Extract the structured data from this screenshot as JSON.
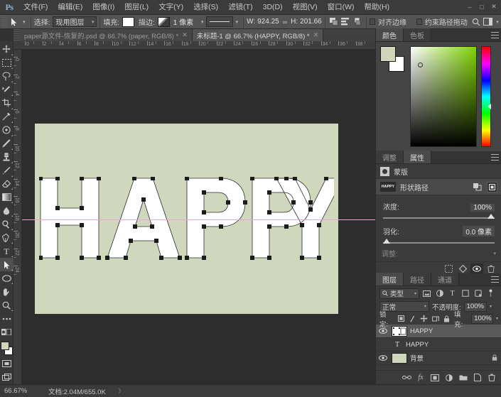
{
  "app": {
    "logo": "Ps",
    "window_buttons": [
      "–",
      "□",
      "✕"
    ]
  },
  "menubar": {
    "items": [
      {
        "label": "文件(F)"
      },
      {
        "label": "编辑(E)"
      },
      {
        "label": "图像(I)"
      },
      {
        "label": "图层(L)"
      },
      {
        "label": "文字(Y)"
      },
      {
        "label": "选择(S)"
      },
      {
        "label": "滤镜(T)"
      },
      {
        "label": "3D(D)"
      },
      {
        "label": "视图(V)"
      },
      {
        "label": "窗口(W)"
      },
      {
        "label": "帮助(H)"
      }
    ]
  },
  "optionsbar": {
    "tool_icon": "path-selection-icon",
    "select_label": "选择:",
    "select_value": "现用图层",
    "fill_label": "填充:",
    "fill_color": "#ffffff",
    "stroke_label": "描边:",
    "stroke_width": "1 像素",
    "stroke_style_label": "——",
    "w_label": "W:",
    "w_value": "924.25",
    "link_icon": "link-icon",
    "h_label": "H:",
    "h_value": "201.66",
    "align_edges_label": "对齐边缘",
    "constrain_path_label": "约束路径拖动"
  },
  "tabs": [
    {
      "label": "paper源文件-恢复的.psd @ 66.7% (paper, RGB/8) *",
      "active": false
    },
    {
      "label": "未标题-1 @ 66.7% (HAPPY, RGB/8) *",
      "active": true
    }
  ],
  "toolbar": {
    "tools": [
      {
        "name": "move-tool",
        "active": false
      },
      {
        "name": "rectangular-marquee-tool",
        "active": false
      },
      {
        "name": "lasso-tool",
        "active": false
      },
      {
        "name": "quick-selection-tool",
        "active": false
      },
      {
        "name": "crop-tool",
        "active": false
      },
      {
        "name": "eyedropper-tool",
        "active": false
      },
      {
        "name": "spot-healing-brush-tool",
        "active": false
      },
      {
        "name": "brush-tool",
        "active": false
      },
      {
        "name": "clone-stamp-tool",
        "active": false
      },
      {
        "name": "history-brush-tool",
        "active": false
      },
      {
        "name": "eraser-tool",
        "active": false
      },
      {
        "name": "gradient-tool",
        "active": false
      },
      {
        "name": "blur-tool",
        "active": false
      },
      {
        "name": "dodge-tool",
        "active": false
      },
      {
        "name": "pen-tool",
        "active": false
      },
      {
        "name": "type-tool",
        "active": false
      },
      {
        "name": "path-selection-tool",
        "active": true
      },
      {
        "name": "rectangle-tool",
        "active": false
      },
      {
        "name": "hand-tool",
        "active": false
      },
      {
        "name": "zoom-tool",
        "active": false
      },
      {
        "name": "edit-toolbar-tool",
        "active": false
      }
    ],
    "foreground_color": "#cfd6bc",
    "background_color": "#ffffff"
  },
  "rulers": {
    "h_ticks": [
      "0",
      "2",
      "4",
      "6",
      "8",
      "10",
      "12",
      "14",
      "16",
      "18",
      "20",
      "22",
      "24",
      "26",
      "28",
      "30",
      "32",
      "34",
      "36",
      "38"
    ],
    "v_ticks": [
      "0",
      "2",
      "4",
      "6",
      "8",
      "10",
      "12",
      "14",
      "16",
      "18",
      "20",
      "22",
      "24"
    ]
  },
  "canvas": {
    "artboard_color": "#cfd8bd",
    "word": "HAPPY",
    "word_color": "#ffffff",
    "guide_color": "#7fdbd4"
  },
  "color_panel": {
    "tabs": [
      {
        "label": "颜色",
        "active": true
      },
      {
        "label": "色板",
        "active": false
      }
    ],
    "foreground": "#cfd6bc",
    "background": "#ffffff",
    "hue_color": "#7fd400"
  },
  "properties_panel": {
    "tabs": [
      {
        "label": "调整",
        "active": false
      },
      {
        "label": "属性",
        "active": true
      }
    ],
    "header_label": "蒙版",
    "row_label": "形状路径",
    "row_thumb_text": "HAPPY",
    "density_label": "浓度:",
    "density_value": "100%",
    "feather_label": "羽化:",
    "feather_value": "0.0 像素",
    "adjust_label": "调整:",
    "icons": [
      "pixel-mask-icon",
      "color-range-icon",
      "invert-icon",
      "delete-icon"
    ]
  },
  "layers_panel": {
    "tabs": [
      {
        "label": "图层",
        "active": true
      },
      {
        "label": "路径",
        "active": false
      },
      {
        "label": "通道",
        "active": false
      }
    ],
    "filter_label": "类型",
    "filter_icons": [
      "image-filter-icon",
      "adjustment-filter-icon",
      "type-filter-icon",
      "shape-filter-icon",
      "smartobject-filter-icon"
    ],
    "blend_mode": "正常",
    "opacity_label": "不透明度:",
    "opacity_value": "100%",
    "lock_label": "锁定:",
    "lock_icons": [
      "lock-transparency-icon",
      "lock-image-icon",
      "lock-position-icon",
      "lock-artboard-icon",
      "lock-all-icon"
    ],
    "fill_label": "填充:",
    "fill_value": "100%",
    "layers": [
      {
        "name": "HAPPY",
        "type": "shape-mask",
        "visible": true,
        "selected": true,
        "locked": false
      },
      {
        "name": "HAPPY",
        "type": "text",
        "visible": false,
        "selected": false,
        "locked": false
      },
      {
        "name": "背景",
        "type": "background",
        "visible": true,
        "selected": false,
        "locked": true
      }
    ],
    "footer_icons": [
      "link-layers-icon",
      "layer-style-icon",
      "layer-mask-icon",
      "adjustment-layer-icon",
      "new-group-icon",
      "new-layer-icon",
      "delete-layer-icon"
    ]
  },
  "statusbar": {
    "zoom": "66.67%",
    "doc_info": "文档:2.04M/655.0K",
    "arrow": "〉"
  }
}
